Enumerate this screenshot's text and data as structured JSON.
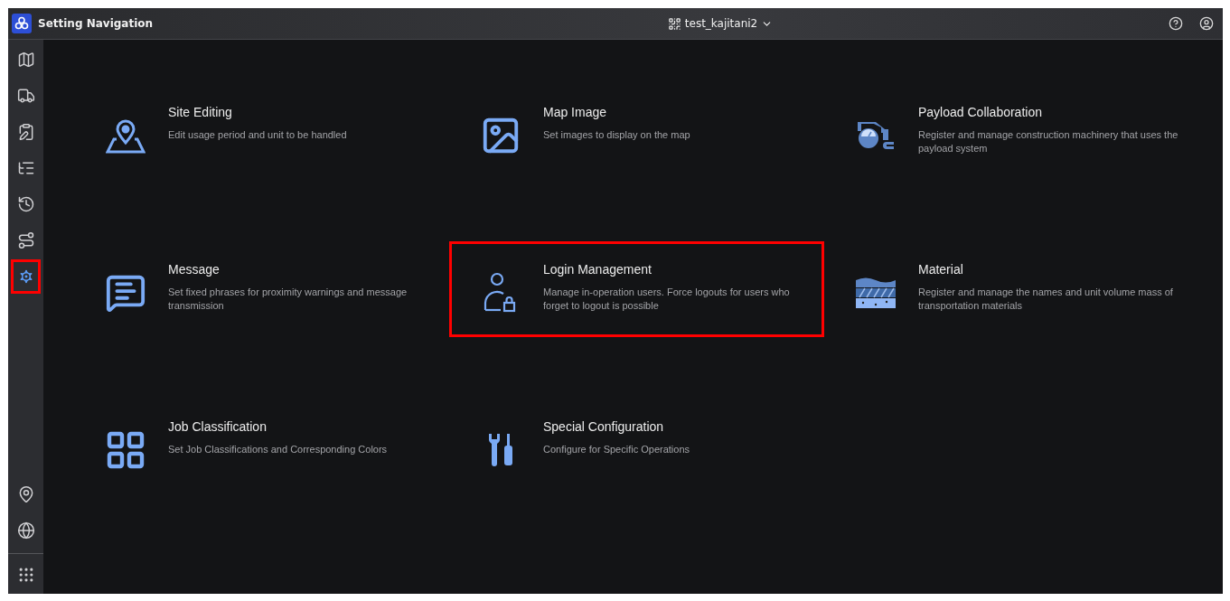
{
  "header": {
    "title": "Setting Navigation",
    "project": "test_kajitani2"
  },
  "sidebar": {
    "items": [
      {
        "kind": "map",
        "selected": false,
        "highlighted": false
      },
      {
        "kind": "truck",
        "selected": false,
        "highlighted": false
      },
      {
        "kind": "plan",
        "selected": false,
        "highlighted": false
      },
      {
        "kind": "list",
        "selected": false,
        "highlighted": false
      },
      {
        "kind": "history",
        "selected": false,
        "highlighted": false
      },
      {
        "kind": "route",
        "selected": false,
        "highlighted": false
      },
      {
        "kind": "settings",
        "selected": true,
        "highlighted": true
      }
    ],
    "bottom_items": [
      {
        "kind": "pin",
        "selected": false
      },
      {
        "kind": "globe",
        "selected": false
      },
      {
        "kind": "apps",
        "selected": false
      }
    ]
  },
  "cards": [
    {
      "kind": "site",
      "title": "Site Editing",
      "description": "Edit usage period and unit to be handled",
      "highlighted": false
    },
    {
      "kind": "image",
      "title": "Map Image",
      "description": "Set images to display on the map",
      "highlighted": false
    },
    {
      "kind": "payload",
      "title": "Payload Collaboration",
      "description": "Register and manage construction machinery that uses the payload system",
      "highlighted": false
    },
    {
      "kind": "message",
      "title": "Message",
      "description": "Set fixed phrases for proximity warnings and message transmission",
      "highlighted": false
    },
    {
      "kind": "login",
      "title": "Login Management",
      "description": "Manage in-operation users. Force logouts for users who forget to logout is possible",
      "highlighted": true
    },
    {
      "kind": "material",
      "title": "Material",
      "description": "Register and manage the names and unit volume mass of transportation materials",
      "highlighted": false
    },
    {
      "kind": "job",
      "title": "Job Classification",
      "description": "Set Job Classifications and Corresponding Colors",
      "highlighted": false
    },
    {
      "kind": "special",
      "title": "Special Configuration",
      "description": "Configure for Specific Operations",
      "highlighted": false
    }
  ]
}
